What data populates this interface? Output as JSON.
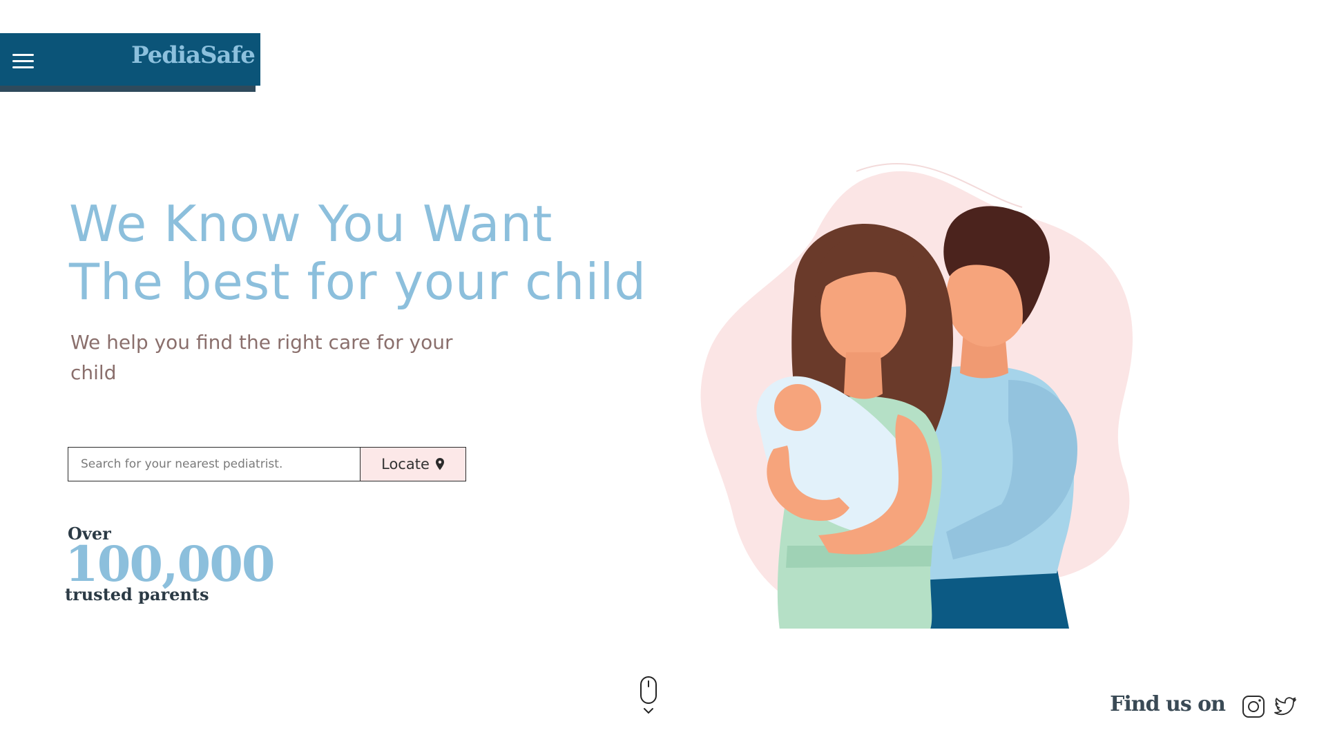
{
  "header": {
    "brand": "PediaSafe",
    "menu_icon": "hamburger-menu-icon"
  },
  "hero": {
    "title_line1": "We Know You Want",
    "title_line2": "The best for your child",
    "subtitle": "We help you find the right care for your child"
  },
  "search": {
    "placeholder": "Search for your nearest pediatrist.",
    "value": "",
    "button_label": "Locate",
    "button_icon": "map-pin-icon"
  },
  "stats": {
    "prefix": "Over",
    "number": "100,000",
    "caption": "trusted parents"
  },
  "footer": {
    "find_us_label": "Find us on",
    "social": [
      "instagram-icon",
      "twitter-icon"
    ],
    "scroll_icon": "mouse-scroll-icon"
  },
  "colors": {
    "brand_bar": "#0b5478",
    "accent_blue": "#8cbfdc",
    "subtitle": "#8a6f6c",
    "locate_bg": "#fce8e8",
    "dark_text": "#2b3a45"
  }
}
